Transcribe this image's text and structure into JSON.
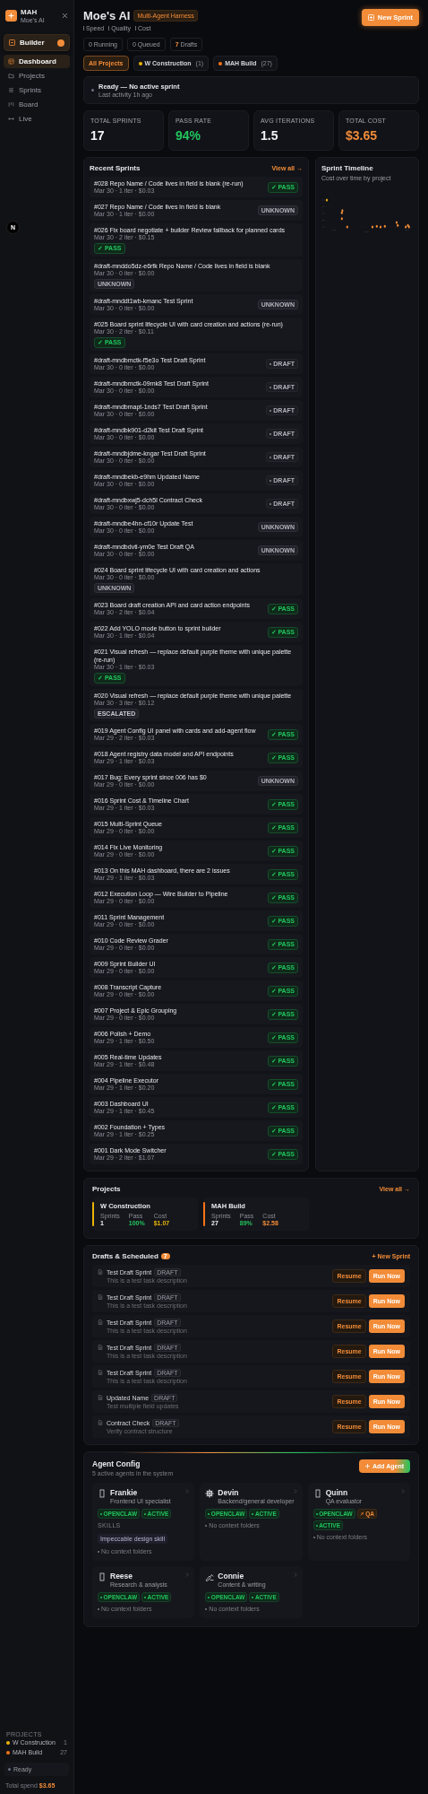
{
  "sidebar": {
    "brand": {
      "name": "MAH",
      "subtitle": "Moe's AI"
    },
    "builder": {
      "label": "Builder",
      "notification": true
    },
    "nav": [
      {
        "label": "Dashboard",
        "selected": true
      },
      {
        "label": "Projects",
        "selected": false
      },
      {
        "label": "Sprints",
        "selected": false
      },
      {
        "label": "Board",
        "selected": false
      },
      {
        "label": "Live",
        "selected": false
      }
    ],
    "dev_badge": "N",
    "projects_heading": "PROJECTS",
    "projects": [
      {
        "name": "W Construction",
        "count": "1",
        "color": "#eab308"
      },
      {
        "name": "MAH Build",
        "count": "27",
        "color": "#f97316"
      }
    ],
    "status": "Ready",
    "spend_label": "Total spend",
    "spend_value": "$3.65"
  },
  "header": {
    "title": "Moe's AI",
    "tag": "Multi-Agent Harness",
    "legend": [
      "Speed",
      "Quality",
      "Cost"
    ],
    "new_button": "New Sprint"
  },
  "counters": [
    {
      "value": "0",
      "label": "Running",
      "highlight": false
    },
    {
      "value": "0",
      "label": "Queued",
      "highlight": false
    },
    {
      "value": "7",
      "label": "Drafts",
      "highlight": true
    }
  ],
  "filters": [
    {
      "label": "All Projects",
      "selected": true
    },
    {
      "label": "W Construction",
      "count": "(1)",
      "color": "#eab308",
      "selected": false
    },
    {
      "label": "MAH Build",
      "count": "(27)",
      "color": "#f97316",
      "selected": false
    }
  ],
  "status_card": {
    "title": "Ready — No active sprint",
    "subtitle": "Last activity 1h ago"
  },
  "stats": [
    {
      "label": "TOTAL SPRINTS",
      "value": "17",
      "kind": "plain"
    },
    {
      "label": "PASS RATE",
      "value": "94%",
      "kind": "success"
    },
    {
      "label": "AVG ITERATIONS",
      "value": "1.5",
      "kind": "plain"
    },
    {
      "label": "TOTAL COST",
      "value": "$3.65",
      "kind": "accent"
    }
  ],
  "recent": {
    "title": "Recent Sprints",
    "link": "View all →",
    "items": [
      {
        "title": "#028 Repo Name / Code lives in field is blank (re-run)",
        "meta": "Mar 30 · 1 iter · $0.03",
        "kind": "pass",
        "badge": "✓ PASS"
      },
      {
        "title": "#027 Repo Name / Code lives in field is blank",
        "meta": "Mar 30 · 1 iter · $0.00",
        "kind": "unknown",
        "badge": "UNKNOWN"
      },
      {
        "title": "#026 Fix board negotiate + builder Review fallback for planned cards",
        "meta": "Mar 30 · 2 iter · $0.15",
        "kind": "pass",
        "badge": "✓ PASS"
      },
      {
        "title": "#draft-mnddo5dz-e6rfk Repo Name / Code lives in field is blank",
        "meta": "Mar 30 · 0 iter · $0.00",
        "kind": "unknown",
        "badge": "UNKNOWN"
      },
      {
        "title": "#draft-mnddt1wb-kmanc Test Sprint",
        "meta": "Mar 30 · 0 iter · $0.00",
        "kind": "unknown",
        "badge": "UNKNOWN"
      },
      {
        "title": "#025 Board sprint lifecycle UI with card creation and actions (re-run)",
        "meta": "Mar 30 · 2 iter · $0.11",
        "kind": "pass",
        "badge": "✓ PASS"
      },
      {
        "title": "#draft-mndbmctk-f5e3o Test Draft Sprint",
        "meta": "Mar 30 · 0 iter · $0.00",
        "kind": "draft",
        "badge": "DRAFT"
      },
      {
        "title": "#draft-mndbmctk-09mk8 Test Draft Sprint",
        "meta": "Mar 30 · 0 iter · $0.00",
        "kind": "draft",
        "badge": "DRAFT"
      },
      {
        "title": "#draft-mndbmapt-1nds7 Test Draft Sprint",
        "meta": "Mar 30 · 0 iter · $0.00",
        "kind": "draft",
        "badge": "DRAFT"
      },
      {
        "title": "#draft-mndbk901-d2kit Test Draft Sprint",
        "meta": "Mar 30 · 0 iter · $0.00",
        "kind": "draft",
        "badge": "DRAFT"
      },
      {
        "title": "#draft-mndbjdme-kngar Test Draft Sprint",
        "meta": "Mar 30 · 0 iter · $0.00",
        "kind": "draft",
        "badge": "DRAFT"
      },
      {
        "title": "#draft-mndbekb-e9hm Updated Name",
        "meta": "Mar 30 · 0 iter · $0.00",
        "kind": "draft",
        "badge": "DRAFT"
      },
      {
        "title": "#draft-mndbxwj5-dch5l Contract Check",
        "meta": "Mar 30 · 0 iter · $0.00",
        "kind": "draft",
        "badge": "DRAFT"
      },
      {
        "title": "#draft-mndbe4hn-cf10r Update Test",
        "meta": "Mar 30 · 0 iter · $0.00",
        "kind": "unknown",
        "badge": "UNKNOWN"
      },
      {
        "title": "#draft-mndbdvti-ym0e Test Draft QA",
        "meta": "Mar 30 · 0 iter · $0.00",
        "kind": "unknown",
        "badge": "UNKNOWN"
      },
      {
        "title": "#024 Board sprint lifecycle UI with card creation and actions",
        "meta": "Mar 30 · 0 iter · $0.00",
        "kind": "unknown",
        "badge": "UNKNOWN"
      },
      {
        "title": "#023 Board draft creation API and card action endpoints",
        "meta": "Mar 30 · 2 iter · $0.04",
        "kind": "pass",
        "badge": "✓ PASS"
      },
      {
        "title": "#022 Add YOLO mode button to sprint builder",
        "meta": "Mar 30 · 1 iter · $0.04",
        "kind": "pass",
        "badge": "✓ PASS"
      },
      {
        "title": "#021 Visual refresh — replace default purple theme with unique palette (re-run)",
        "meta": "Mar 30 · 1 iter · $0.03",
        "kind": "pass",
        "badge": "✓ PASS"
      },
      {
        "title": "#020 Visual refresh — replace default purple theme with unique palette",
        "meta": "Mar 30 · 3 iter · $0.12",
        "kind": "escalated",
        "badge": "ESCALATED"
      },
      {
        "title": "#019 Agent Config UI panel with cards and add-agent flow",
        "meta": "Mar 29 · 2 iter · $0.03",
        "kind": "pass",
        "badge": "✓ PASS"
      },
      {
        "title": "#018 Agent registry data model and API endpoints",
        "meta": "Mar 29 · 1 iter · $0.03",
        "kind": "pass",
        "badge": "✓ PASS"
      },
      {
        "title": "#017 Bug: Every sprint since 006 has $0",
        "meta": "Mar 29 · 0 iter · $0.00",
        "kind": "unknown",
        "badge": "UNKNOWN"
      },
      {
        "title": "#016 Sprint Cost & Timeline Chart",
        "meta": "Mar 29 · 1 iter · $0.03",
        "kind": "pass",
        "badge": "✓ PASS"
      },
      {
        "title": "#015 Multi-Sprint Queue",
        "meta": "Mar 29 · 0 iter · $0.00",
        "kind": "pass",
        "badge": "✓ PASS"
      },
      {
        "title": "#014 Fix Live Monitoring",
        "meta": "Mar 29 · 0 iter · $0.00",
        "kind": "pass",
        "badge": "✓ PASS"
      },
      {
        "title": "#013 On this MAH dashboard, there are 2 issues",
        "meta": "Mar 29 · 1 iter · $0.03",
        "kind": "pass",
        "badge": "✓ PASS"
      },
      {
        "title": "#012 Execution Loop — Wire Builder to Pipeline",
        "meta": "Mar 29 · 0 iter · $0.00",
        "kind": "pass",
        "badge": "✓ PASS"
      },
      {
        "title": "#011 Sprint Management",
        "meta": "Mar 29 · 0 iter · $0.00",
        "kind": "pass",
        "badge": "✓ PASS"
      },
      {
        "title": "#010 Code Review Grader",
        "meta": "Mar 29 · 0 iter · $0.00",
        "kind": "pass",
        "badge": "✓ PASS"
      },
      {
        "title": "#009 Sprint Builder UI",
        "meta": "Mar 29 · 0 iter · $0.00",
        "kind": "pass",
        "badge": "✓ PASS"
      },
      {
        "title": "#008 Transcript Capture",
        "meta": "Mar 29 · 0 iter · $0.00",
        "kind": "pass",
        "badge": "✓ PASS"
      },
      {
        "title": "#007 Project & Epic Grouping",
        "meta": "Mar 29 · 0 iter · $0.00",
        "kind": "pass",
        "badge": "✓ PASS"
      },
      {
        "title": "#006 Polish + Demo",
        "meta": "Mar 29 · 1 iter · $0.50",
        "kind": "pass",
        "badge": "✓ PASS"
      },
      {
        "title": "#005 Real-time Updates",
        "meta": "Mar 29 · 1 iter · $0.48",
        "kind": "pass",
        "badge": "✓ PASS"
      },
      {
        "title": "#004 Pipeline Executor",
        "meta": "Mar 29 · 1 iter · $0.20",
        "kind": "pass",
        "badge": "✓ PASS"
      },
      {
        "title": "#003 Dashboard UI",
        "meta": "Mar 29 · 1 iter · $0.45",
        "kind": "pass",
        "badge": "✓ PASS"
      },
      {
        "title": "#002 Foundation + Types",
        "meta": "Mar 29 · 1 iter · $0.25",
        "kind": "pass",
        "badge": "✓ PASS"
      },
      {
        "title": "#001 Dark Mode Switcher",
        "meta": "Mar 29 · 2 iter · $1.07",
        "kind": "pass",
        "badge": "✓ PASS"
      }
    ]
  },
  "timeline": {
    "title": "Sprint Timeline",
    "subtitle": "Cost over time by project"
  },
  "projects": {
    "title": "Projects",
    "link": "View all →",
    "items": [
      {
        "name": "W Construction",
        "color": "#eab308",
        "stats": [
          {
            "label": "Sprints",
            "value": "1",
            "kind": "plain"
          },
          {
            "label": "Pass",
            "value": "100%",
            "kind": "success"
          },
          {
            "label": "Cost",
            "value": "$1.07",
            "kind": "warning"
          }
        ]
      },
      {
        "name": "MAH Build",
        "color": "#f97316",
        "stats": [
          {
            "label": "Sprints",
            "value": "27",
            "kind": "plain"
          },
          {
            "label": "Pass",
            "value": "89%",
            "kind": "success"
          },
          {
            "label": "Cost",
            "value": "$2.58",
            "kind": "accent"
          }
        ]
      }
    ]
  },
  "drafts": {
    "title": "Drafts & Scheduled",
    "count": "7",
    "link": "+ New Sprint",
    "items": [
      {
        "name": "Test Draft Sprint",
        "tag": "DRAFT",
        "description": "This is a test task description",
        "resume": "Resume",
        "run": "Run Now"
      },
      {
        "name": "Test Draft Sprint",
        "tag": "DRAFT",
        "description": "This is a test task description",
        "resume": "Resume",
        "run": "Run Now"
      },
      {
        "name": "Test Draft Sprint",
        "tag": "DRAFT",
        "description": "This is a test task description",
        "resume": "Resume",
        "run": "Run Now"
      },
      {
        "name": "Test Draft Sprint",
        "tag": "DRAFT",
        "description": "This is a test task description",
        "resume": "Resume",
        "run": "Run Now"
      },
      {
        "name": "Test Draft Sprint",
        "tag": "DRAFT",
        "description": "This is a test task description",
        "resume": "Resume",
        "run": "Run Now"
      },
      {
        "name": "Updated Name",
        "tag": "DRAFT",
        "description": "Test multiple field updates",
        "resume": "Resume",
        "run": "Run Now"
      },
      {
        "name": "Contract Check",
        "tag": "DRAFT",
        "description": "Verify contract structure",
        "resume": "Resume",
        "run": "Run Now"
      }
    ]
  },
  "agents": {
    "title": "Agent Config",
    "subtitle": "5 active agents in the system",
    "add_button": "Add Agent",
    "items": [
      {
        "name": "Frankie",
        "role": "Frontend UI specialist",
        "tags": [
          {
            "label": "OPENCLAW",
            "kind": "runtime"
          },
          {
            "label": "ACTIVE",
            "kind": "status"
          }
        ],
        "skills_heading": "SKILLS",
        "skills": [
          "Impeccable design skill"
        ],
        "folders": "No context folders"
      },
      {
        "name": "Devin",
        "role": "Backend/general developer",
        "tags": [
          {
            "label": "OPENCLAW",
            "kind": "runtime"
          },
          {
            "label": "ACTIVE",
            "kind": "status"
          }
        ],
        "folders": "No context folders"
      },
      {
        "name": "Quinn",
        "role": "QA evaluator",
        "tags": [
          {
            "label": "OPENCLAW",
            "kind": "runtime"
          },
          {
            "label": "QA",
            "kind": "role"
          },
          {
            "label": "ACTIVE",
            "kind": "status"
          }
        ],
        "folders": "No context folders"
      },
      {
        "name": "Reese",
        "role": "Research & analysis",
        "tags": [
          {
            "label": "OPENCLAW",
            "kind": "runtime"
          },
          {
            "label": "ACTIVE",
            "kind": "status"
          }
        ],
        "folders": "No context folders"
      },
      {
        "name": "Connie",
        "role": "Content & writing",
        "tags": [
          {
            "label": "OPENCLAW",
            "kind": "runtime"
          },
          {
            "label": "ACTIVE",
            "kind": "status"
          }
        ],
        "folders": "No context folders"
      }
    ]
  }
}
